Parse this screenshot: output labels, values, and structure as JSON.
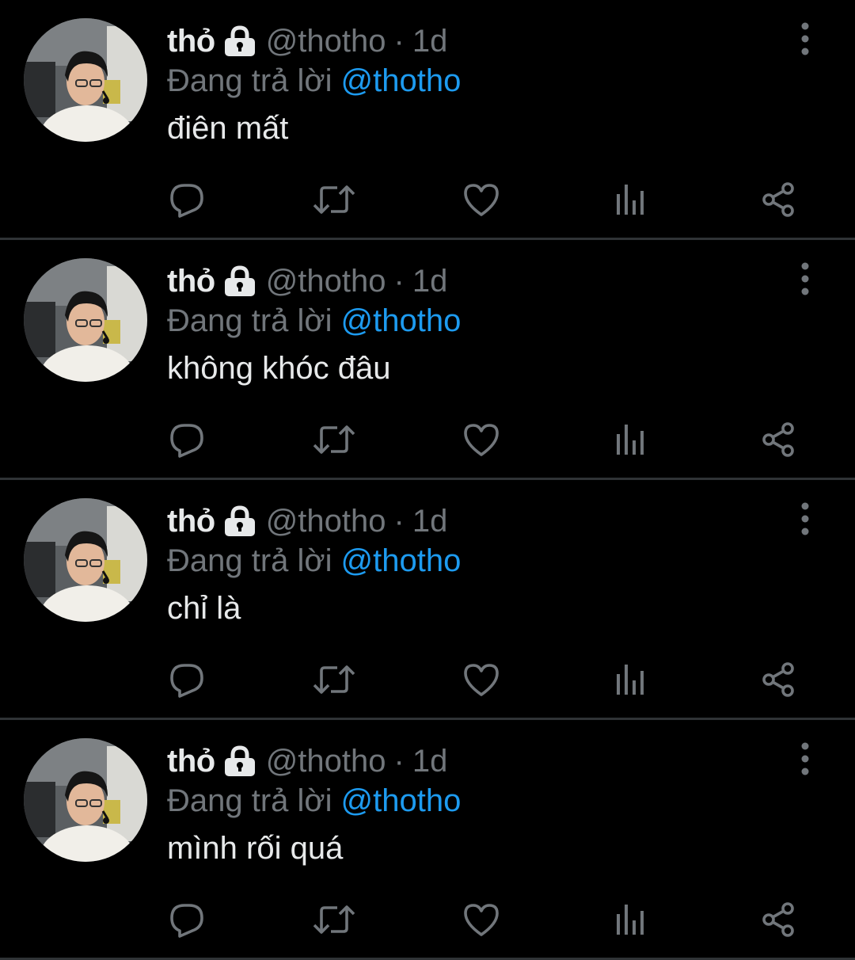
{
  "colors": {
    "background": "#000000",
    "primary_text": "#e7e9ea",
    "secondary_text": "#71767b",
    "mention": "#1d9bf0",
    "divider": "#2f3336"
  },
  "icons": {
    "lock": "lock-icon",
    "more": "more-vertical-icon",
    "reply": "reply-bubble-icon",
    "retweet": "retweet-icon",
    "like": "heart-icon",
    "views": "bar-chart-icon",
    "share": "share-icon"
  },
  "tweets": [
    {
      "name": "thỏ",
      "handle": "@thotho",
      "separator": "·",
      "time": "1d",
      "reply_prefix": "Đang trả lời",
      "reply_mention": "@thotho",
      "text": "điên mất"
    },
    {
      "name": "thỏ",
      "handle": "@thotho",
      "separator": "·",
      "time": "1d",
      "reply_prefix": "Đang trả lời",
      "reply_mention": "@thotho",
      "text": "không khóc đâu"
    },
    {
      "name": "thỏ",
      "handle": "@thotho",
      "separator": "·",
      "time": "1d",
      "reply_prefix": "Đang trả lời",
      "reply_mention": "@thotho",
      "text": "chỉ là"
    },
    {
      "name": "thỏ",
      "handle": "@thotho",
      "separator": "·",
      "time": "1d",
      "reply_prefix": "Đang trả lời",
      "reply_mention": "@thotho",
      "text": "mình rối quá"
    }
  ]
}
